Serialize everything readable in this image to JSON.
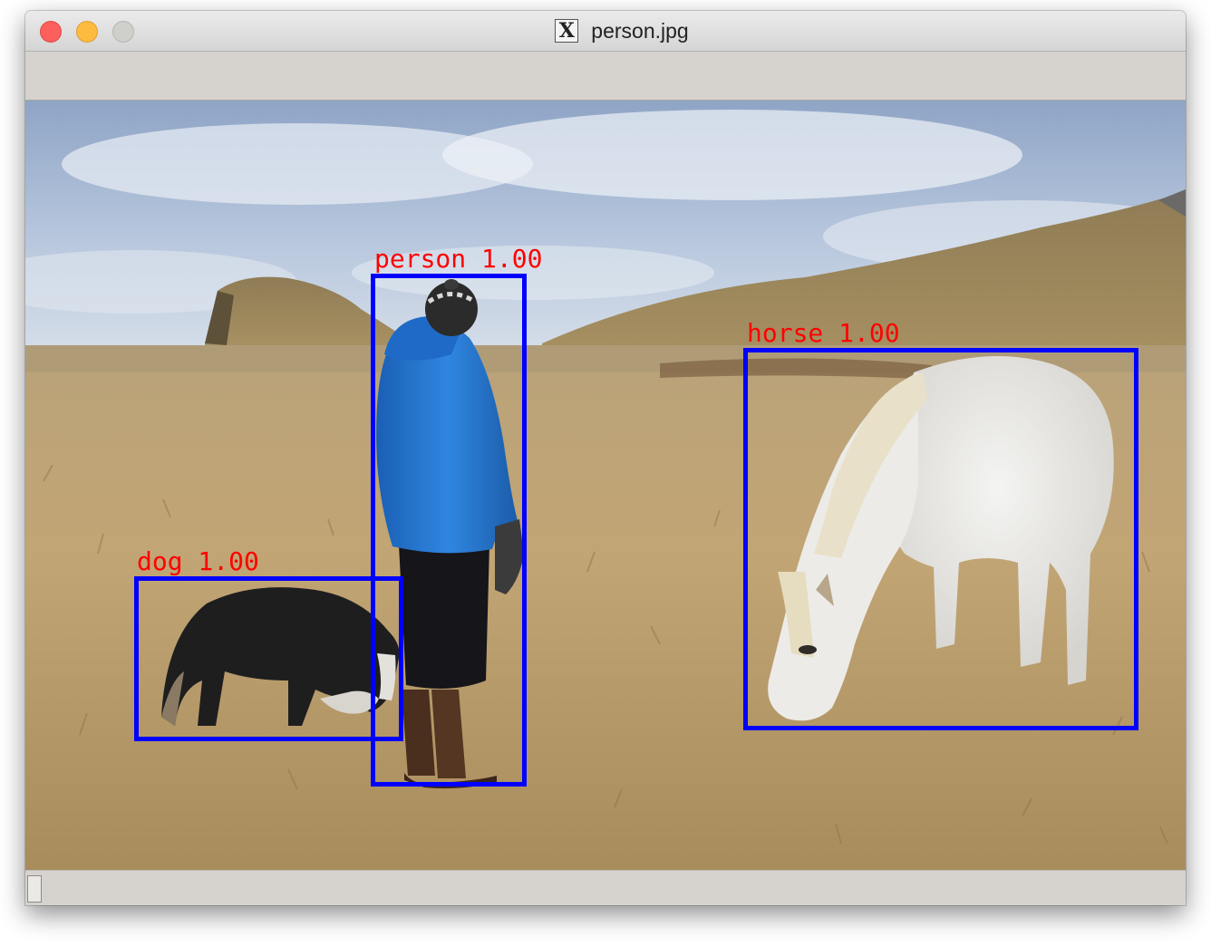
{
  "window": {
    "title": "person.jpg",
    "app_icon": "x11-icon"
  },
  "colors": {
    "box": "#0000ff",
    "label": "#ff0000"
  },
  "detections": [
    {
      "class": "person",
      "score": "1.00",
      "label": "person 1.00"
    },
    {
      "class": "horse",
      "score": "1.00",
      "label": "horse 1.00"
    },
    {
      "class": "dog",
      "score": "1.00",
      "label": "dog 1.00"
    }
  ]
}
